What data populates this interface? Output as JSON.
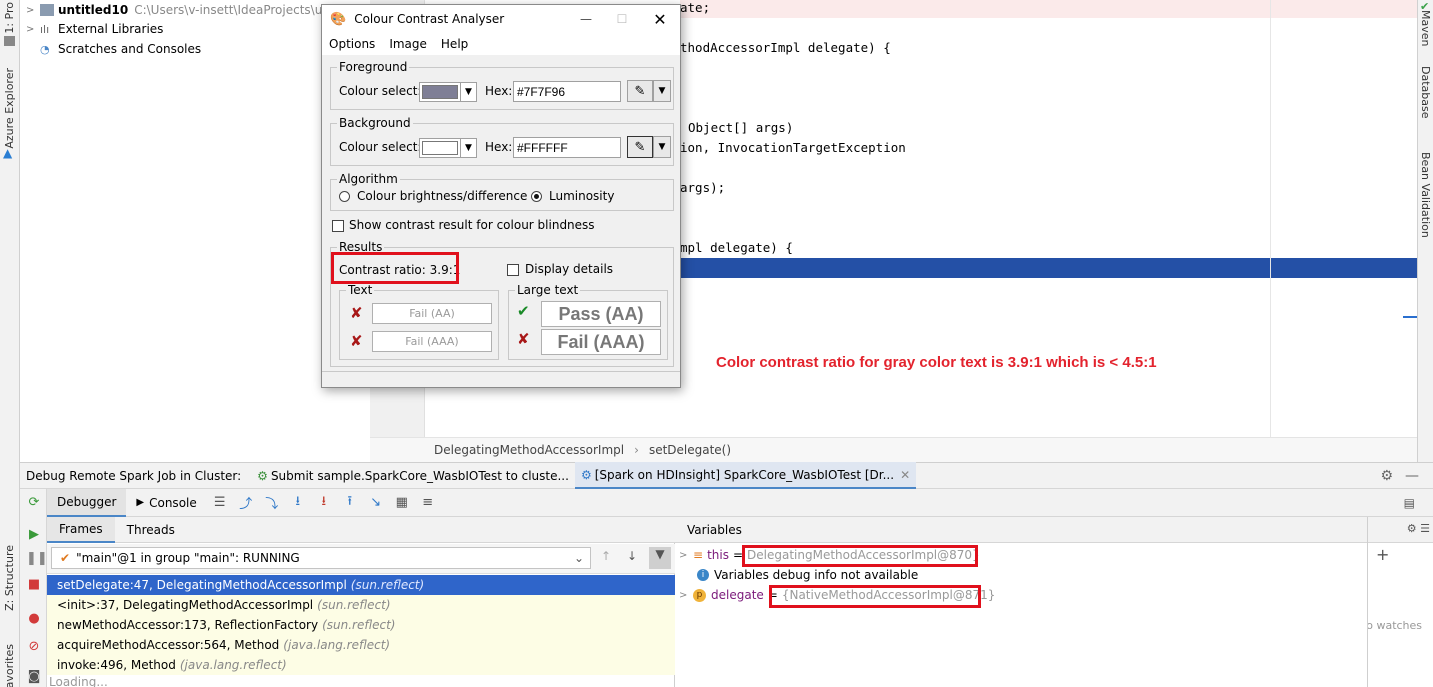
{
  "left_strip": {
    "top_tab": "1: Pro",
    "azure": "Azure Explorer",
    "structure": "Z: Structure",
    "favorites": "Favorites"
  },
  "right_strip": {
    "maven": "Maven",
    "database": "Database",
    "bean": "Bean Validation"
  },
  "project_tree": [
    {
      "label": "untitled10",
      "path": "C:\\Users\\v-insett\\IdeaProjects\\untitled"
    },
    {
      "label": "External Libraries"
    },
    {
      "label": "Scratches and Consoles"
    }
  ],
  "editor": {
    "lines": [
      "ate;",
      "thodAccessorImpl delegate) {",
      "Object[] args)",
      "ion, InvocationTargetException",
      "args);",
      "mpl delegate) {"
    ],
    "annotation": "Color contrast ratio for gray color text is 3.9:1 which is < 4.5:1",
    "breadcrumb": [
      "DelegatingMethodAccessorImpl",
      "setDelegate()"
    ]
  },
  "dialog": {
    "title": "Colour Contrast Analyser",
    "menu": [
      "Options",
      "Image",
      "Help"
    ],
    "foreground": {
      "group": "Foreground",
      "colour_select": "Colour select:",
      "hex_label": "Hex:",
      "hex": "#7F7F96",
      "swatch": "#7f7f96"
    },
    "background": {
      "group": "Background",
      "colour_select": "Colour select:",
      "hex_label": "Hex:",
      "hex": "#FFFFFF",
      "swatch": "#ffffff"
    },
    "algorithm": {
      "group": "Algorithm",
      "option1": "Colour brightness/difference",
      "option2": "Luminosity",
      "selected": "Luminosity"
    },
    "blindness": "Show contrast result for colour blindness",
    "results": {
      "group": "Results",
      "contrast": "Contrast ratio: 3.9:1",
      "display_details": "Display details",
      "text_group": "Text",
      "text_aa": "Fail (AA)",
      "text_aaa": "Fail (AAA)",
      "large_group": "Large text",
      "large_aa": "Pass (AA)",
      "large_aaa": "Fail (AAA)"
    }
  },
  "debug": {
    "title": "Debug Remote Spark Job in Cluster:",
    "tabs": [
      "Submit sample.SparkCore_WasbIOTest to cluste...",
      "[Spark on HDInsight] SparkCore_WasbIOTest [Dr..."
    ],
    "toolbar": {
      "debugger": "Debugger",
      "console": "Console"
    },
    "frames_tabs": [
      "Frames",
      "Threads"
    ],
    "thread": "\"main\"@1 in group \"main\": RUNNING",
    "frames": [
      {
        "method": "setDelegate:47, DelegatingMethodAccessorImpl",
        "pkg": "(sun.reflect)"
      },
      {
        "method": "<init>:37, DelegatingMethodAccessorImpl",
        "pkg": "(sun.reflect)"
      },
      {
        "method": "newMethodAccessor:173, ReflectionFactory",
        "pkg": "(sun.reflect)"
      },
      {
        "method": "acquireMethodAccessor:564, Method",
        "pkg": "(java.lang.reflect)"
      },
      {
        "method": "invoke:496, Method",
        "pkg": "(java.lang.reflect)"
      }
    ],
    "loading": "Loading...",
    "variables_header": "Variables",
    "variables": [
      {
        "name": "this",
        "eq": "=",
        "value": "DelegatingMethodAccessorImpl@870}"
      },
      {
        "info": "Variables debug info not available"
      },
      {
        "name": "delegate",
        "eq": "=",
        "value": "{NativeMethodAccessorImpl@871}"
      }
    ],
    "watches": "No watches"
  }
}
